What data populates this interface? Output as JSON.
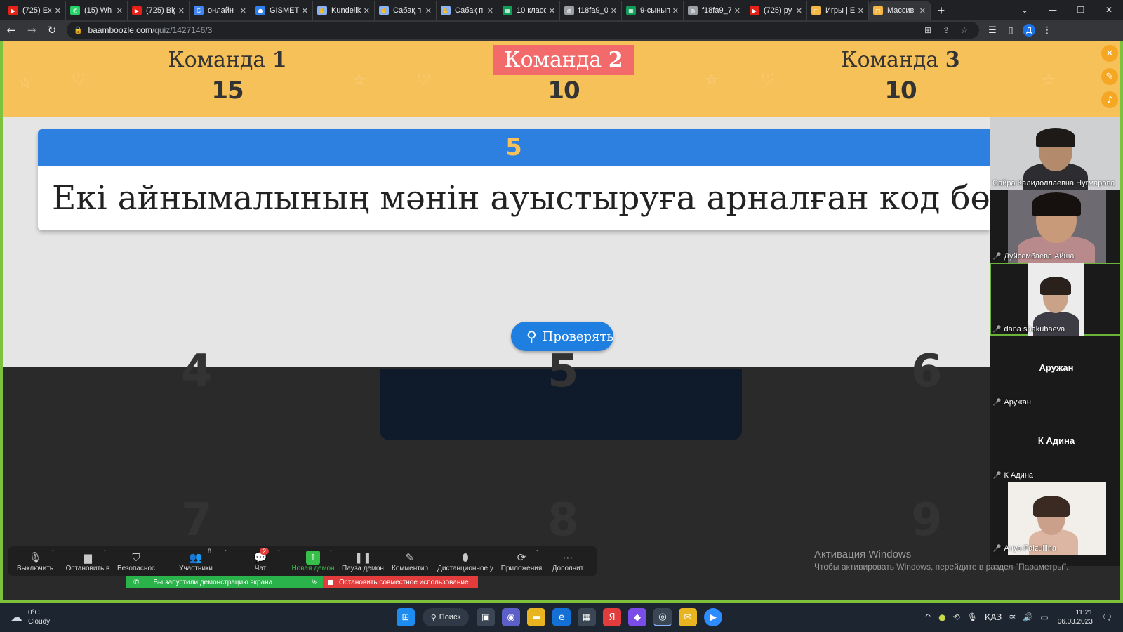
{
  "browser": {
    "tabs": [
      {
        "label": "(725) Ex",
        "icon": "youtube-icon",
        "color": "#e62117"
      },
      {
        "label": "(15) Wh",
        "icon": "whatsapp-icon",
        "color": "#25d366"
      },
      {
        "label": "(725) Big",
        "icon": "youtube-icon",
        "color": "#e62117"
      },
      {
        "label": "онлайн",
        "icon": "google-icon",
        "color": "#4285f4"
      },
      {
        "label": "GISMETI",
        "icon": "gismeteo-icon",
        "color": "#2f80ed"
      },
      {
        "label": "Kundelik",
        "icon": "kundelik-icon",
        "color": "#8ab4f8"
      },
      {
        "label": "Сабақ п",
        "icon": "kundelik-icon",
        "color": "#8ab4f8"
      },
      {
        "label": "Сабақ п",
        "icon": "kundelik-icon",
        "color": "#8ab4f8"
      },
      {
        "label": "10 класс",
        "icon": "sheets-icon",
        "color": "#0f9d58"
      },
      {
        "label": "f18fa9_0",
        "icon": "globe-icon",
        "color": "#9aa0a6"
      },
      {
        "label": "9-сынып",
        "icon": "sheets-icon",
        "color": "#0f9d58"
      },
      {
        "label": "f18fa9_7",
        "icon": "globe-icon",
        "color": "#9aa0a6"
      },
      {
        "label": "(725) ру",
        "icon": "youtube-icon",
        "color": "#e62117"
      },
      {
        "label": "Игры | E",
        "icon": "baamboozle-icon",
        "color": "#f5b642"
      },
      {
        "label": "Массив",
        "icon": "baamboozle-icon",
        "color": "#f5b642"
      }
    ],
    "url_host": "baamboozle.com",
    "url_path": "/quiz/1427146/3",
    "profile_initial": "Д"
  },
  "game": {
    "teams": [
      {
        "prefix": "Команда ",
        "number": "1",
        "score": "15"
      },
      {
        "prefix": "Команда ",
        "number": "2",
        "score": "10"
      },
      {
        "prefix": "Команда ",
        "number": "3",
        "score": "10"
      }
    ],
    "active_team": 2,
    "question_number": "5",
    "question_text": "Екі айнымалының мәнін ауыстыруға арналған код бөлігі",
    "check_button": "Проверять",
    "board_numbers": [
      "4",
      "5",
      "6",
      "7",
      "8",
      "9"
    ]
  },
  "participants": [
    {
      "name": "Сайра Калидоллаевна Нугмарова",
      "video": true,
      "muted": false
    },
    {
      "name": "Дуйсембаева Айша",
      "video": true,
      "muted": true
    },
    {
      "name": "dana shakubaeva",
      "video": true,
      "muted": true,
      "active": true
    },
    {
      "name": "Аружан",
      "video": false,
      "muted": true,
      "display": "Аружан"
    },
    {
      "name": "К Адина",
      "video": false,
      "muted": true,
      "display": "К Адина"
    },
    {
      "name": "Anya Faizullina",
      "video": true,
      "muted": true
    }
  ],
  "zoom_toolbar": {
    "mute": "Выключить",
    "video": "Остановить в",
    "security": "Безопаснос",
    "participants": "Участники",
    "participants_count": "8",
    "chat": "Чат",
    "chat_badge": "2",
    "new_share": "Новая демон",
    "pause_share": "Пауза демон",
    "annotate": "Комментир",
    "remote_control": "Дистанционное у",
    "apps": "Приложения",
    "more": "Дополнит"
  },
  "share_status": {
    "started": "Вы запустили демонстрацию экрана",
    "stop": "Остановить совместное использование"
  },
  "windows_activation": {
    "title": "Активация Windows",
    "subtitle": "Чтобы активировать Windows, перейдите в раздел \"Параметры\"."
  },
  "taskbar": {
    "temperature": "0°C",
    "weather": "Cloudy",
    "search": "Поиск",
    "language": "ҚАЗ",
    "time": "11:21",
    "date": "06.03.2023"
  }
}
